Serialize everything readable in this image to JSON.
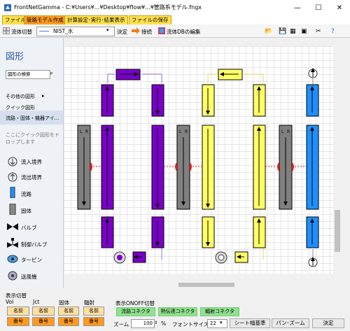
{
  "window": {
    "title": "FrontNetGamma - C:¥Users¥...¥Desktop¥flow¥...¥管路系モデル.fngx",
    "min": "—",
    "max": "☐",
    "close": "✕"
  },
  "tabs": [
    {
      "label": "ファイル",
      "active": false
    },
    {
      "label": "管路モデル作成",
      "active": true
    },
    {
      "label": "計算設定･実行･結果表示",
      "active": false
    },
    {
      "label": "ファイルの保存",
      "active": false
    }
  ],
  "toolbar": {
    "fluid_switch": "流体切替",
    "fluid_value": "NIST_水",
    "confirm": "決定",
    "connect": "接続",
    "fluid_db_edit": "流体DBの編集"
  },
  "left_panel": {
    "title": "図形",
    "search_placeholder": "図形の検索",
    "other_shapes": "その他の図形",
    "quick_shapes": "クイック図形",
    "category_selected": "流路・固体・機器アイ...",
    "drop_hint_1": "ここにクイック図形をド",
    "drop_hint_2": "ロップします",
    "items": [
      {
        "label": "流入境界",
        "icon": "inflow-boundary-icon"
      },
      {
        "label": "流出境界",
        "icon": "outflow-boundary-icon"
      },
      {
        "label": "流路",
        "icon": "flow-path-icon"
      },
      {
        "label": "固体",
        "icon": "solid-icon"
      },
      {
        "label": "バルブ",
        "icon": "valve-icon"
      },
      {
        "label": "制御バルブ",
        "icon": "control-valve-icon"
      },
      {
        "label": "ターピン",
        "icon": "turbine-icon"
      },
      {
        "label": "送風機",
        "icon": "blower-icon"
      }
    ]
  },
  "diagram": {
    "colors": {
      "purple": "#7a00c8",
      "yellow": "#ffff66",
      "blue": "#1e90ff",
      "gray": "#808080",
      "red": "#e02020"
    },
    "solid_labels": {
      "left": "L",
      "right": "R"
    }
  },
  "bottom": {
    "display_switch": "表示切替",
    "cols": [
      "Vol",
      "Jct",
      "固体",
      "輻射"
    ],
    "name_label": "名前",
    "number_label": "番号",
    "onoff_title": "表示ONOFF切替",
    "connectors": [
      "流路コネクタ",
      "熱伝達コネクタ",
      "輻射コネクタ"
    ],
    "zoom_label": "ズーム",
    "zoom_value": "100",
    "percent": "%",
    "font_size_label": "フォントサイズ",
    "font_size_value": "22",
    "sheet_width_button": "シート幅基準",
    "pan_zoom_button": "パン･ズーム",
    "decide_button": "決定"
  }
}
